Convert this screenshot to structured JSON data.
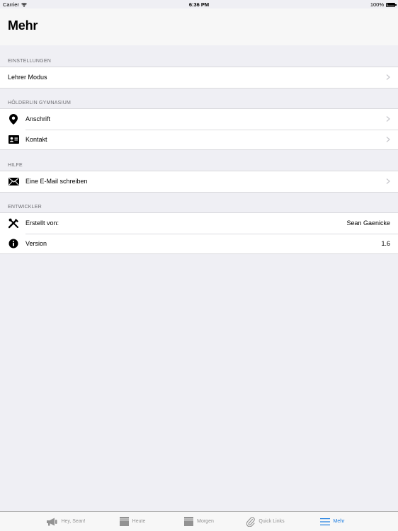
{
  "status": {
    "carrier": "Carrier",
    "time": "6:36 PM",
    "battery": "100%"
  },
  "page_title": "Mehr",
  "sections": {
    "einstellungen": {
      "header": "EINSTELLUNGEN",
      "rows": [
        {
          "label": "Lehrer Modus"
        }
      ]
    },
    "schule": {
      "header": "HÖLDERLIN GYMNASIUM",
      "rows": [
        {
          "label": "Anschrift",
          "icon": "location-pin-icon"
        },
        {
          "label": "Kontakt",
          "icon": "contact-card-icon"
        }
      ]
    },
    "hilfe": {
      "header": "HILFE",
      "rows": [
        {
          "label": "Eine E-Mail schreiben",
          "icon": "envelope-icon"
        }
      ]
    },
    "entwickler": {
      "header": "ENTWICKLER",
      "rows": [
        {
          "label": "Erstellt von:",
          "value": "Sean Gaenicke",
          "icon": "tools-icon"
        },
        {
          "label": "Version",
          "value": "1.6",
          "icon": "info-icon"
        }
      ]
    }
  },
  "tabs": [
    {
      "label": "Hey, Sean!",
      "icon": "megaphone-icon"
    },
    {
      "label": "Heute",
      "icon": "document-stack-icon"
    },
    {
      "label": "Morgen",
      "icon": "document-stack-icon"
    },
    {
      "label": "Quick Links",
      "icon": "paperclip-icon"
    },
    {
      "label": "Mehr",
      "icon": "hamburger-menu-icon",
      "active": true
    }
  ],
  "colors": {
    "accent": "#1a7ce0",
    "background": "#efeff4",
    "tab_inactive": "#929292",
    "section_header": "#6d6d72"
  }
}
